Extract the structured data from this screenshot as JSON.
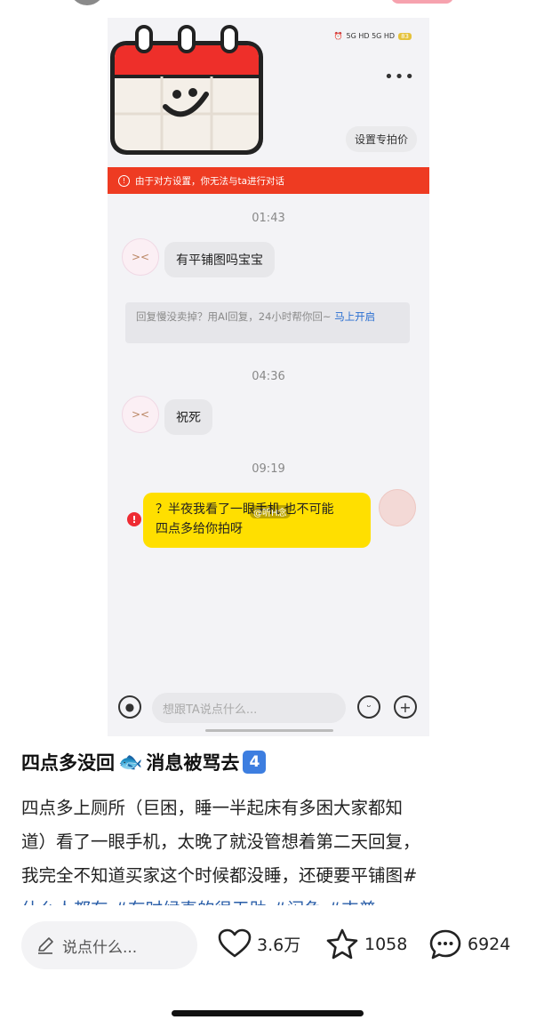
{
  "chat": {
    "status": {
      "network": "5G HD 5G HD",
      "battery": "83"
    },
    "price_button": "设置专拍价",
    "banner": "由于对方设置，你无法与ta进行对话",
    "messages": [
      {
        "time": "01:43",
        "text": "有平铺图吗宝宝"
      },
      {
        "time": "04:36",
        "text": "祝死"
      }
    ],
    "ai_tip": {
      "text": "回复慢没卖掉？用AI回复，24小时帮你回~ ",
      "link": "马上开启"
    },
    "my_message": {
      "time": "09:19",
      "line1": "？半夜我看了一眼手机 也不可能",
      "line2": "四点多给你拍呀"
    },
    "watermark": "@听H念",
    "input_placeholder": "想跟TA说点什么..."
  },
  "post": {
    "title": "四点多没回",
    "title_suffix": "消息被骂去",
    "title_badge": "4",
    "body_line1": "四点多上厕所（巨困，睡一半起床有多困大家都知",
    "body_line2": "道）看了一眼手机，太晚了就没管想着第二天回复，",
    "body_line3": "我完全不知道买家这个时候都没睡，还硬要平铺图#",
    "body_tags": "什么人都有 #有时候真的很无助 #闲鱼 #吉普"
  },
  "bar": {
    "comment_placeholder": "说点什么...",
    "likes": "3.6万",
    "favorites": "1058",
    "comments": "6924"
  }
}
